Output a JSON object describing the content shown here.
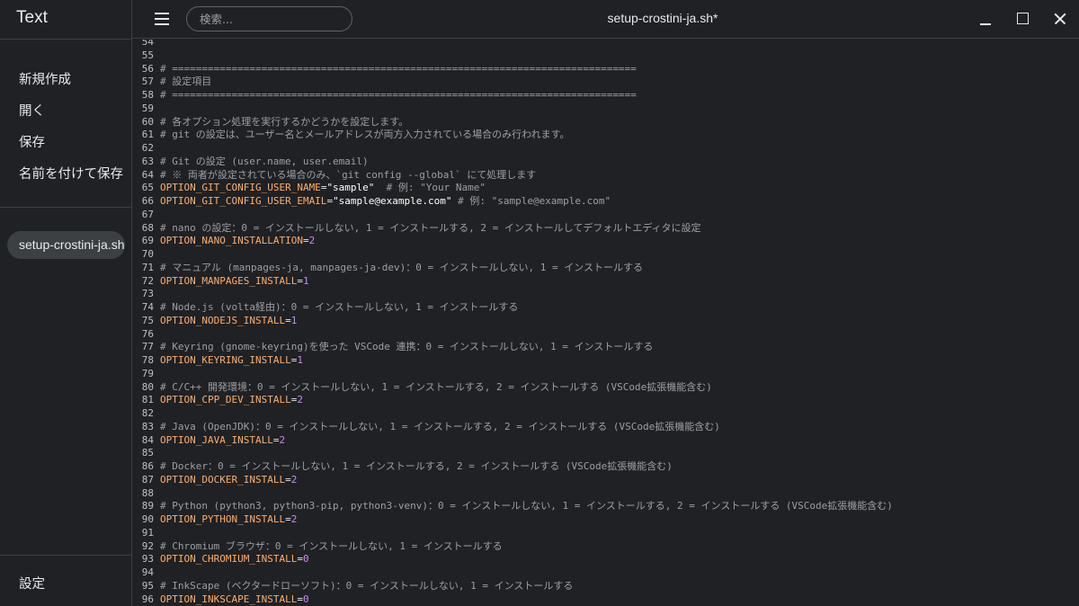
{
  "app": {
    "title": "Text"
  },
  "sidebar": {
    "menu": [
      "新規作成",
      "開く",
      "保存",
      "名前を付けて保存"
    ],
    "open_files": [
      "setup-crostini-ja.sh"
    ],
    "settings_label": "設定"
  },
  "toolbar": {
    "search_placeholder": "検索...",
    "document_title": "setup-crostini-ja.sh*"
  },
  "icons": {
    "menu": "hamburger-menu-icon",
    "minimize": "minimize-icon",
    "maximize": "maximize-icon",
    "close": "close-icon"
  },
  "colors": {
    "background": "#202124",
    "comment": "#9aa0a6",
    "variable": "#fcad70",
    "number": "#c58af9",
    "string": "#ffffff"
  },
  "editor": {
    "lines": [
      {
        "n": 54,
        "t": "blank"
      },
      {
        "n": 55,
        "t": "blank"
      },
      {
        "n": 56,
        "t": "comment",
        "text": "# =============================================================================="
      },
      {
        "n": 57,
        "t": "comment",
        "text": "# 設定項目"
      },
      {
        "n": 58,
        "t": "comment",
        "text": "# =============================================================================="
      },
      {
        "n": 59,
        "t": "blank"
      },
      {
        "n": 60,
        "t": "comment",
        "text": "# 各オプション処理を実行するかどうかを設定します。"
      },
      {
        "n": 61,
        "t": "comment",
        "text": "# git の設定は、ユーザー名とメールアドレスが両方入力されている場合のみ行われます。"
      },
      {
        "n": 62,
        "t": "blank"
      },
      {
        "n": 63,
        "t": "comment",
        "text": "# Git の設定 (user.name, user.email)"
      },
      {
        "n": 64,
        "t": "comment",
        "text": "# ※ 両者が設定されている場合のみ、`git config --global` にて処理します"
      },
      {
        "n": 65,
        "t": "assign",
        "var": "OPTION_GIT_CONFIG_USER_NAME",
        "str": "\"sample\"",
        "comment": "  # 例: \"Your Name\""
      },
      {
        "n": 66,
        "t": "assign",
        "var": "OPTION_GIT_CONFIG_USER_EMAIL",
        "str": "\"sample@example.com\"",
        "comment": " # 例: \"sample@example.com\""
      },
      {
        "n": 67,
        "t": "blank"
      },
      {
        "n": 68,
        "t": "comment",
        "text": "# nano の設定：0 = インストールしない, 1 = インストールする, 2 = インストールしてデフォルトエディタに設定"
      },
      {
        "n": 69,
        "t": "assign",
        "var": "OPTION_NANO_INSTALLATION",
        "num": "2"
      },
      {
        "n": 70,
        "t": "blank"
      },
      {
        "n": 71,
        "t": "comment",
        "text": "# マニュアル (manpages-ja, manpages-ja-dev)：0 = インストールしない, 1 = インストールする"
      },
      {
        "n": 72,
        "t": "assign",
        "var": "OPTION_MANPAGES_INSTALL",
        "num": "1"
      },
      {
        "n": 73,
        "t": "blank"
      },
      {
        "n": 74,
        "t": "comment",
        "text": "# Node.js (volta経由)：0 = インストールしない, 1 = インストールする"
      },
      {
        "n": 75,
        "t": "assign",
        "var": "OPTION_NODEJS_INSTALL",
        "num": "1"
      },
      {
        "n": 76,
        "t": "blank"
      },
      {
        "n": 77,
        "t": "comment",
        "text": "# Keyring (gnome-keyring)を使った VSCode 連携：0 = インストールしない, 1 = インストールする"
      },
      {
        "n": 78,
        "t": "assign",
        "var": "OPTION_KEYRING_INSTALL",
        "num": "1"
      },
      {
        "n": 79,
        "t": "blank"
      },
      {
        "n": 80,
        "t": "comment",
        "text": "# C/C++ 開発環境：0 = インストールしない, 1 = インストールする, 2 = インストールする (VSCode拡張機能含む)"
      },
      {
        "n": 81,
        "t": "assign",
        "var": "OPTION_CPP_DEV_INSTALL",
        "num": "2"
      },
      {
        "n": 82,
        "t": "blank"
      },
      {
        "n": 83,
        "t": "comment",
        "text": "# Java (OpenJDK)：0 = インストールしない, 1 = インストールする, 2 = インストールする (VSCode拡張機能含む)"
      },
      {
        "n": 84,
        "t": "assign",
        "var": "OPTION_JAVA_INSTALL",
        "num": "2"
      },
      {
        "n": 85,
        "t": "blank"
      },
      {
        "n": 86,
        "t": "comment",
        "text": "# Docker：0 = インストールしない, 1 = インストールする, 2 = インストールする (VSCode拡張機能含む)"
      },
      {
        "n": 87,
        "t": "assign",
        "var": "OPTION_DOCKER_INSTALL",
        "num": "2"
      },
      {
        "n": 88,
        "t": "blank"
      },
      {
        "n": 89,
        "t": "comment",
        "text": "# Python (python3, python3-pip, python3-venv)：0 = インストールしない, 1 = インストールする, 2 = インストールする (VSCode拡張機能含む)"
      },
      {
        "n": 90,
        "t": "assign",
        "var": "OPTION_PYTHON_INSTALL",
        "num": "2"
      },
      {
        "n": 91,
        "t": "blank"
      },
      {
        "n": 92,
        "t": "comment",
        "text": "# Chromium ブラウザ：0 = インストールしない, 1 = インストールする"
      },
      {
        "n": 93,
        "t": "assign",
        "var": "OPTION_CHROMIUM_INSTALL",
        "num": "0"
      },
      {
        "n": 94,
        "t": "blank"
      },
      {
        "n": 95,
        "t": "comment",
        "text": "# InkScape (ベクタードローソフト)：0 = インストールしない, 1 = インストールする"
      },
      {
        "n": 96,
        "t": "assign",
        "var": "OPTION_INKSCAPE_INSTALL",
        "num": "0"
      }
    ]
  }
}
